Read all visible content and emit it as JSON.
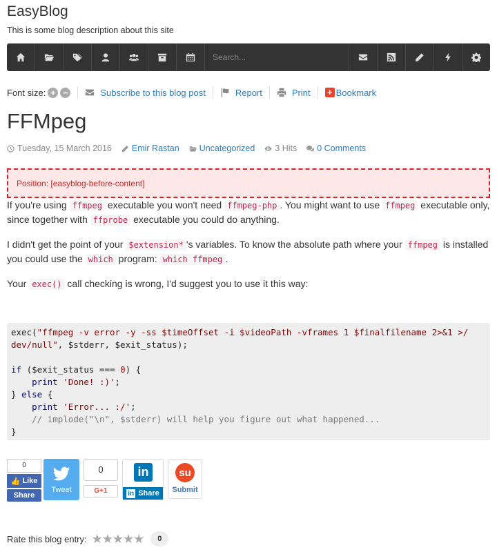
{
  "site": {
    "title": "EasyBlog",
    "description": "This is some blog description about this site"
  },
  "navbar": {
    "left_icons": [
      "home-icon",
      "folder-icon",
      "tags-icon",
      "user-icon",
      "users-icon",
      "archive-icon",
      "calendar-icon"
    ],
    "search_placeholder": "Search...",
    "right_icons": [
      "envelope-icon",
      "rss-icon",
      "pencil-icon",
      "bolt-icon",
      "gear-icon"
    ]
  },
  "tools": {
    "font_size_label": "Font size:",
    "increase": "+",
    "decrease": "−",
    "subscribe": "Subscribe to this blog post",
    "report": "Report",
    "print": "Print",
    "bookmark_icon": "+",
    "bookmark": "Bookmark"
  },
  "post": {
    "title": "FFMpeg",
    "date": "Tuesday, 15 March 2016",
    "author": "Emir Rastan",
    "category": "Uncategorized",
    "hits": "3 Hits",
    "comments": "0 Comments"
  },
  "module_position": "Position: [easyblog-before-content]",
  "content": {
    "p1": {
      "t1": "If you're using ",
      "c1": "ffmpeg",
      "t2": " executable you won't need ",
      "c2": "ffmpeg-php",
      "t3": ". You might want to use ",
      "c3": "ffmpeg",
      "t4": " executable only, since together with ",
      "c4": "ffprobe",
      "t5": " executable you could do anything."
    },
    "p2": {
      "t1": "I didn't get the point of your ",
      "c1": "$extension*",
      "t2": "'s variables. To know the absolute path where your ",
      "c2": "ffmpeg",
      "t3": " is installed you could use the ",
      "c3": "which",
      "t4": " program: ",
      "c4": "which ffmpeg",
      "t5": "."
    },
    "p3": {
      "t1": "Your ",
      "c1": "exec()",
      "t2": " call checking is wrong, I'd suggest you to use it this way:"
    }
  },
  "code": {
    "l1_fn": "exec(",
    "l1_str": "\"ffmpeg -v error -y -ss $timeOffset -i $videoPath -vframes 1 $finalfilename 2>&1 >/\ndev/null\"",
    "l1_rest": ", $stderr, $exit_status);",
    "l3_if": "if",
    "l3_a": " ($exit_status === ",
    "l3_num": "0",
    "l3_b": ") {",
    "l4_print": "print",
    "l4_str": "'Done! :)'",
    "l5_a": "} ",
    "l5_else": "else",
    "l5_b": " {",
    "l6_print": "print",
    "l6_str": "'Error... :/'",
    "l7_comment": "// implode(\"\\n\", $stderr) will help you figure out what happened...",
    "l8": "}"
  },
  "social": {
    "fb_count": "0",
    "fb_like": "Like",
    "fb_share": "Share",
    "tweet": "Tweet",
    "gplus_count": "0",
    "gplus": "G+1",
    "linkedin_logo": "in",
    "linkedin_share": "Share",
    "stumble_logo": "su",
    "stumble": "Submit"
  },
  "rating": {
    "label": "Rate this blog entry:",
    "stars": "★★★★★",
    "count": "0"
  }
}
